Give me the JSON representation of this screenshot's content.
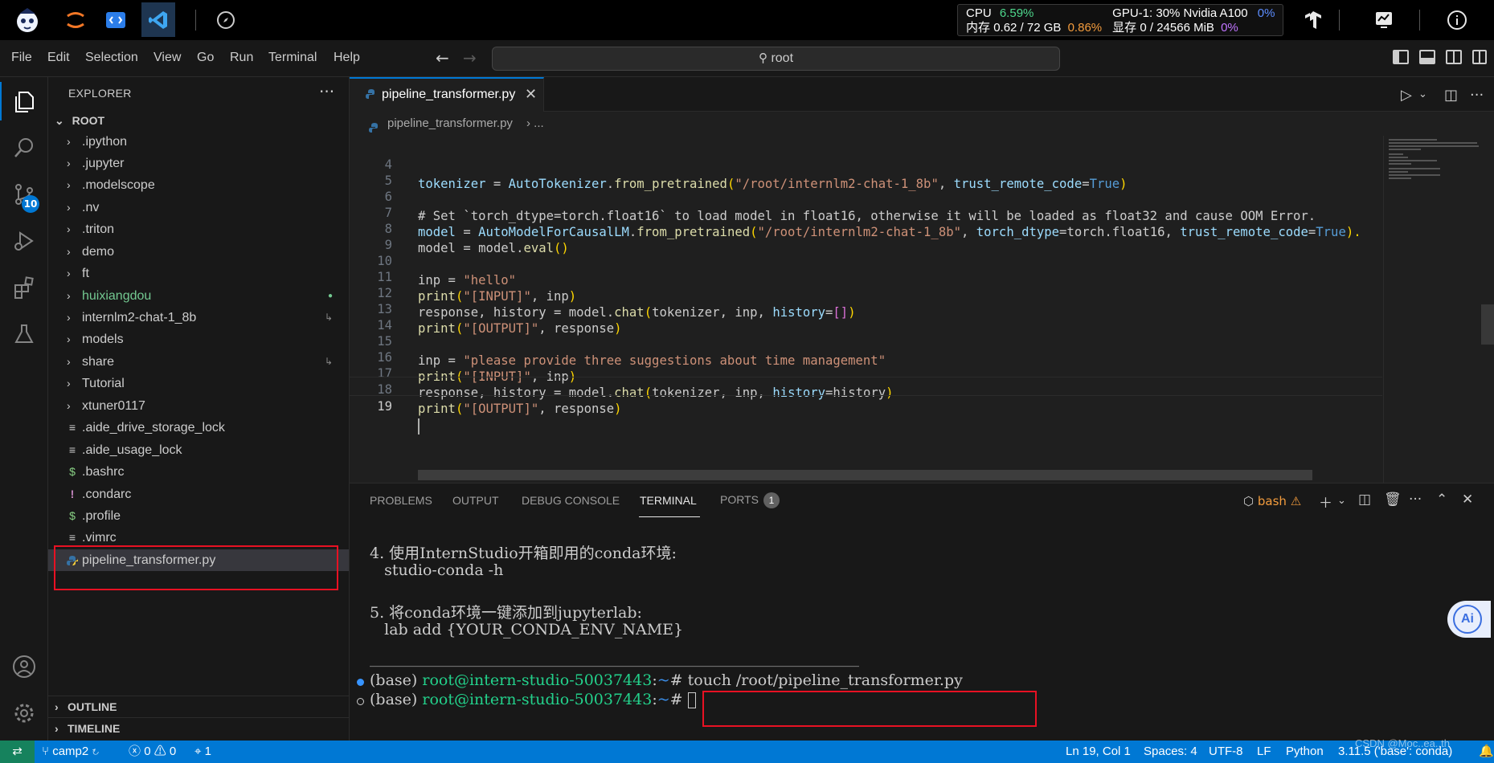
{
  "sysbar": {
    "cpu_label": "CPU",
    "cpu_value": "6.59%",
    "mem_label": "内存",
    "mem_value": "0.62 / 72 GB",
    "mem_pct": "0.86%",
    "gpu_label": "GPU-1: 30% Nvidia A100",
    "gpu_pct": "0%",
    "vram_label": "显存",
    "vram_value": "0 / 24566 MiB",
    "vram_pct": "0%"
  },
  "menu": {
    "items": [
      "File",
      "Edit",
      "Selection",
      "View",
      "Go",
      "Run",
      "Terminal",
      "Help"
    ],
    "command_center": "root"
  },
  "activity": {
    "scm_badge": "10"
  },
  "sidebar": {
    "title": "EXPLORER",
    "root": "ROOT",
    "items": [
      {
        "label": ".ipython",
        "type": "folder"
      },
      {
        "label": ".jupyter",
        "type": "folder"
      },
      {
        "label": ".modelscope",
        "type": "folder"
      },
      {
        "label": ".nv",
        "type": "folder"
      },
      {
        "label": ".triton",
        "type": "folder"
      },
      {
        "label": "demo",
        "type": "folder"
      },
      {
        "label": "ft",
        "type": "folder"
      },
      {
        "label": "huixiangdou",
        "type": "folder"
      },
      {
        "label": "internlm2-chat-1_8b",
        "type": "folder"
      },
      {
        "label": "models",
        "type": "folder"
      },
      {
        "label": "share",
        "type": "folder"
      },
      {
        "label": "Tutorial",
        "type": "folder"
      },
      {
        "label": "xtuner0117",
        "type": "folder"
      },
      {
        "label": ".aide_drive_storage_lock",
        "type": "file"
      },
      {
        "label": ".aide_usage_lock",
        "type": "file"
      },
      {
        "label": ".bashrc",
        "type": "shell"
      },
      {
        "label": ".condarc",
        "type": "yaml"
      },
      {
        "label": ".profile",
        "type": "shell"
      },
      {
        "label": ".vimrc",
        "type": "file"
      },
      {
        "label": "pipeline_transformer.py",
        "type": "python"
      }
    ],
    "outline": "OUTLINE",
    "timeline": "TIMELINE"
  },
  "editor": {
    "tab_label": "pipeline_transformer.py",
    "breadcrumb_file": "pipeline_transformer.py",
    "breadcrumb_more": "...",
    "line_numbers": [
      "4",
      "5",
      "6",
      "7",
      "8",
      "9",
      "10",
      "11",
      "12",
      "13",
      "14",
      "15",
      "16",
      "17",
      "18",
      "19"
    ],
    "lines": {
      "l4": {
        "a": "tokenizer",
        "b": " = ",
        "c": "AutoTokenizer",
        "d": ".",
        "e": "from_pretrained",
        "f": "(",
        "g": "\"/root/internlm2-chat-1_8b\"",
        "h": ", ",
        "i": "trust_remote_code",
        "j": "=",
        "k": "True",
        "l": ")"
      },
      "l6": "# Set `torch_dtype=torch.float16` to load model in float16, otherwise it will be loaded as float32 and cause OOM Error.",
      "l7": {
        "a": "model",
        "b": " = ",
        "c": "AutoModelForCausalLM",
        "d": ".",
        "e": "from_pretrained",
        "f": "(",
        "g": "\"/root/internlm2-chat-1_8b\"",
        "h": ", ",
        "i": "torch_dtype",
        "j": "=",
        "k": "torch",
        "l": ".",
        "m": "float16",
        "n": ", ",
        "o": "trust_remote_code",
        "p": "=",
        "q": "True",
        "r": ")."
      },
      "l8": {
        "a": "model",
        "b": " = ",
        "c": "model",
        "d": ".",
        "e": "eval",
        "f": "()"
      },
      "l10": {
        "a": "inp",
        "b": " = ",
        "c": "\"hello\""
      },
      "l11": {
        "a": "print",
        "b": "(",
        "c": "\"[INPUT]\"",
        "d": ", ",
        "e": "inp",
        "f": ")"
      },
      "l12": {
        "a": "response",
        "b": ", ",
        "c": "history",
        "d": " = ",
        "e": "model",
        "f": ".",
        "g": "chat",
        "h": "(",
        "i": "tokenizer",
        "j": ", ",
        "k": "inp",
        "l": ", ",
        "m": "history",
        "n": "=",
        "o": "[]",
        "p": ")"
      },
      "l13": {
        "a": "print",
        "b": "(",
        "c": "\"[OUTPUT]\"",
        "d": ", ",
        "e": "response",
        "f": ")"
      },
      "l15": {
        "a": "inp",
        "b": " = ",
        "c": "\"please provide three suggestions about time management\""
      },
      "l16": {
        "a": "print",
        "b": "(",
        "c": "\"[INPUT]\"",
        "d": ", ",
        "e": "inp",
        "f": ")"
      },
      "l17": {
        "a": "response",
        "b": ", ",
        "c": "history",
        "d": " = ",
        "e": "model",
        "f": ".",
        "g": "chat",
        "h": "(",
        "i": "tokenizer",
        "j": ", ",
        "k": "inp",
        "l": ", ",
        "m": "history",
        "n": "=",
        "o": "history",
        "p": ")"
      },
      "l18": {
        "a": "print",
        "b": "(",
        "c": "\"[OUTPUT]\"",
        "d": ", ",
        "e": "response",
        "f": ")"
      }
    }
  },
  "panel": {
    "tabs": [
      "PROBLEMS",
      "OUTPUT",
      "DEBUG CONSOLE",
      "TERMINAL",
      "PORTS"
    ],
    "ports_count": "1",
    "shell": "bash",
    "terminal": {
      "line1": "4. 使用InternStudio开箱即用的conda环境:",
      "line2": "   studio-conda -h",
      "line3": "5. 将conda环境一键添加到jupyterlab:",
      "line4": "   lab add {YOUR_CONDA_ENV_NAME}",
      "separator": "_______________________________________________________________________________________",
      "prompt_env": "(base) ",
      "prompt_user": "root@intern-studio-50037443",
      "prompt_colon": ":",
      "prompt_tilde": "~",
      "prompt_hash": "# ",
      "command": "touch /root/pipeline_transformer.py"
    }
  },
  "ai_button": "Ai",
  "status": {
    "branch": "camp2",
    "errors": "0",
    "warnings": "0",
    "ports": "1",
    "position": "Ln 19, Col 1",
    "spaces": "Spaces: 4",
    "encoding": "UTF-8",
    "eol": "LF",
    "language": "Python",
    "interpreter": "3.11.5 ('base': conda)",
    "watermark": "CSDN @Moc..ea..th"
  },
  "colors": {
    "accent": "#0078d4",
    "status_bar": "#0078d4",
    "remote": "#16825d",
    "highlight_box": "#e81123",
    "git_untracked": "#73c991"
  }
}
